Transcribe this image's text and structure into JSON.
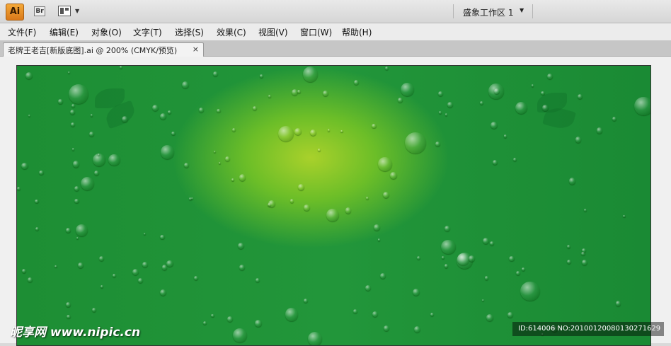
{
  "app": {
    "logo_label": "Ai",
    "bridge_label": "Br",
    "workspace_label": "盛象工作区 1",
    "workspace_arrow": "▼",
    "layout_arrow": "▼"
  },
  "menu": {
    "items": [
      {
        "label": "文件(F)"
      },
      {
        "label": "编辑(E)"
      },
      {
        "label": "对象(O)"
      },
      {
        "label": "文字(T)"
      },
      {
        "label": "选择(S)"
      },
      {
        "label": "效果(C)"
      },
      {
        "label": "视图(V)"
      },
      {
        "label": "窗口(W)"
      },
      {
        "label": "帮助(H)"
      }
    ]
  },
  "document": {
    "tab_title": "老牌王老吉[新版底图].ai @ 200% (CMYK/预览)",
    "close_glyph": "×"
  },
  "watermark": {
    "logo_text": "昵享网 www.nipic.cn",
    "id_text": "ID:614006 NO:20100120080130271629"
  },
  "colors": {
    "ai_orange": "#f4a93a",
    "artboard_green": "#22963a",
    "highlight_yellow": "#a9d12b"
  }
}
